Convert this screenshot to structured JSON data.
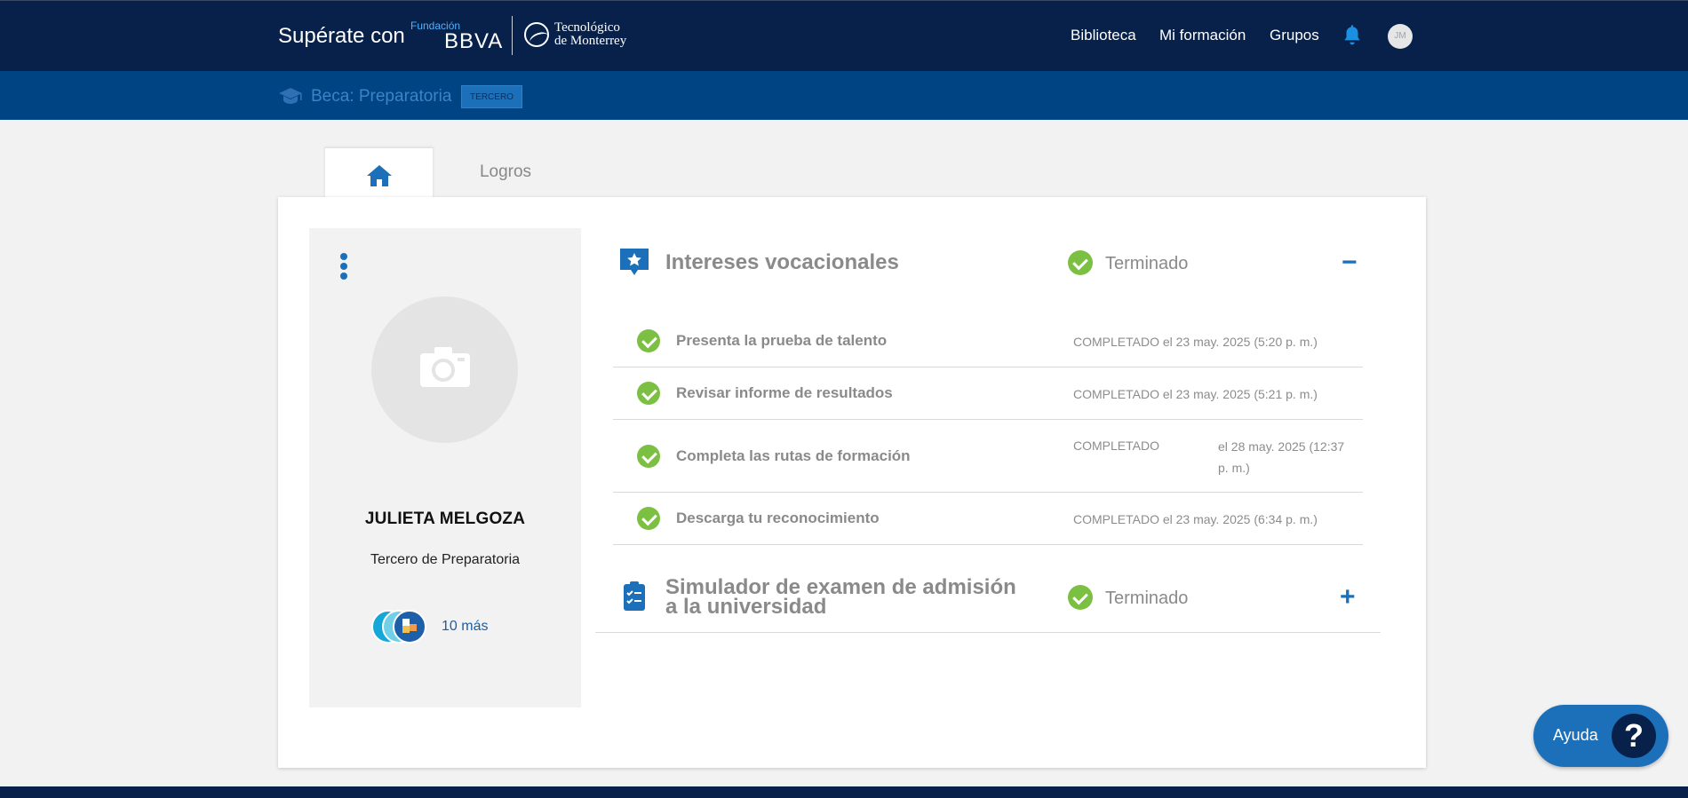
{
  "header": {
    "brand_text": "Supérate con",
    "bbva_foundation": "Fundación",
    "bbva_name": "BBVA",
    "tec_line1": "Tecnológico",
    "tec_line2": "de Monterrey",
    "nav": [
      "Biblioteca",
      "Mi formación",
      "Grupos"
    ],
    "avatar_initials": "JM"
  },
  "subheader": {
    "title": "Beca: Preparatoria",
    "badge": "TERCERO"
  },
  "tabs": {
    "home_icon": "home-icon",
    "logros": "Logros"
  },
  "profile": {
    "name": "JULIETA MELGOZA",
    "grade": "Tercero de Preparatoria",
    "badges_more": "10 más"
  },
  "sections": [
    {
      "title": "Intereses vocacionales",
      "status": "Terminado",
      "toggle": "−",
      "items": [
        {
          "title": "Presenta la prueba de talento",
          "meta": "COMPLETADO el 23 may. 2025 (5:20 p. m.)"
        },
        {
          "title": "Revisar informe de resultados",
          "meta": "COMPLETADO el 23 may. 2025 (5:21 p. m.)"
        },
        {
          "title": "Completa las rutas de formación",
          "meta_status": "COMPLETADO",
          "meta_date_line1": "el 28 may. 2025 (12:37",
          "meta_date_line2": "p. m.)"
        },
        {
          "title": "Descarga tu reconocimiento",
          "meta": "COMPLETADO el 23 may. 2025 (6:34 p. m.)"
        }
      ]
    },
    {
      "title_line1": "Simulador de examen de admisión",
      "title_line2": "a la universidad",
      "status": "Terminado",
      "toggle": "+"
    }
  ],
  "help": {
    "label": "Ayuda",
    "icon": "?"
  },
  "colors": {
    "navbar": "#07214a",
    "subbar": "#004483",
    "accent": "#1b70b9",
    "success": "#7cc043"
  }
}
